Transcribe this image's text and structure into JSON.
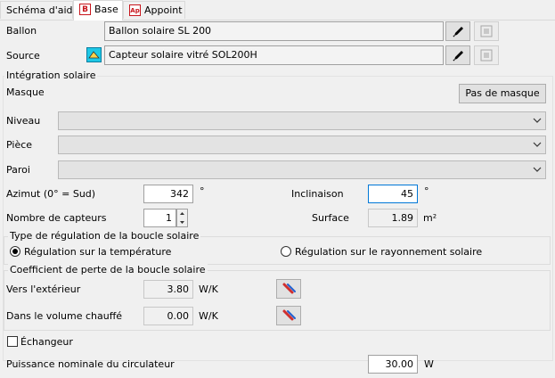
{
  "tabs": [
    {
      "label": "Schéma d'aide"
    },
    {
      "label": "Base",
      "icon_letter": "B"
    },
    {
      "label": "Appoint",
      "icon_letter": "Ap"
    }
  ],
  "ballon": {
    "label": "Ballon",
    "value": "Ballon solaire SL 200"
  },
  "source": {
    "label": "Source",
    "value": "Capteur solaire vitré SOL200H"
  },
  "integration": {
    "title": "Intégration solaire",
    "masque_label": "Masque",
    "masque_button": "Pas de masque",
    "niveau_label": "Niveau",
    "piece_label": "Pièce",
    "paroi_label": "Paroi"
  },
  "azimut": {
    "label": "Azimut (0° = Sud)",
    "value": "342",
    "unit": "°"
  },
  "inclinaison": {
    "label": "Inclinaison",
    "value": "45",
    "unit": "°"
  },
  "nb_capteurs": {
    "label": "Nombre de capteurs",
    "value": "1"
  },
  "surface": {
    "label": "Surface",
    "value": "1.89",
    "unit": "m²"
  },
  "regulation": {
    "title": "Type de régulation de la boucle solaire",
    "option_temp": "Régulation sur la température",
    "option_ray": "Régulation sur le rayonnement solaire",
    "selected": "temperature"
  },
  "perte": {
    "title": "Coefficient de perte de la boucle solaire",
    "exterieur_label": "Vers l'extérieur",
    "exterieur_value": "3.80",
    "volume_label": "Dans le volume chauffé",
    "volume_value": "0.00",
    "unit": "W/K"
  },
  "echangeur": {
    "label": "Échangeur",
    "checked": false
  },
  "circulateur": {
    "label": "Puissance nominale du circulateur",
    "value": "30.00",
    "unit": "W"
  },
  "colors": {
    "accent_red": "#c8161d",
    "focus_blue": "#0078d7",
    "background": "#f0f0f0"
  }
}
